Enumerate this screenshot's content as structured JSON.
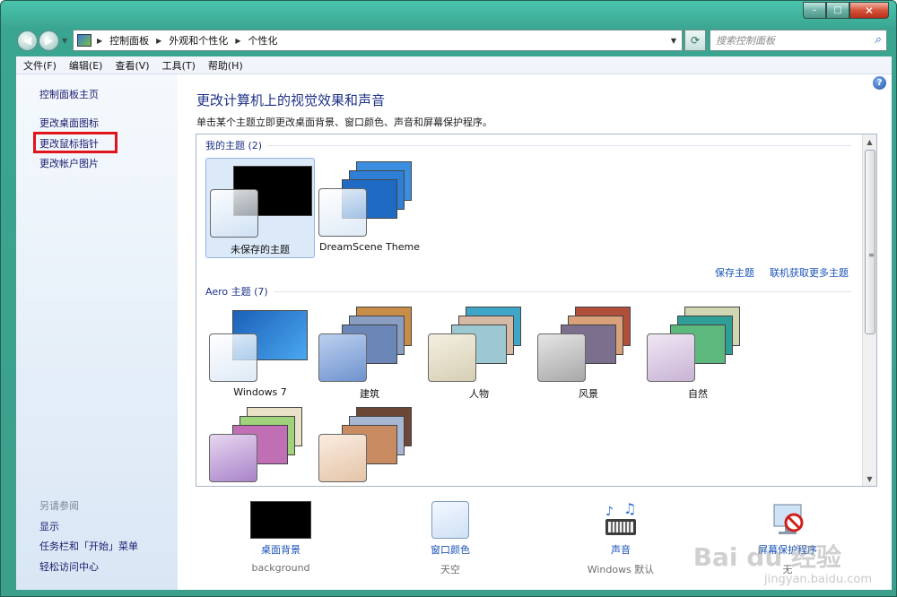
{
  "caption": {
    "minimize": "–",
    "maximize": "□",
    "close": "✕"
  },
  "nav": {
    "back": "◀",
    "forward": "▶",
    "breadcrumb": [
      "控制面板",
      "外观和个性化",
      "个性化"
    ],
    "separator": "▶",
    "search_placeholder": "搜索控制面板"
  },
  "menu": [
    "文件(F)",
    "编辑(E)",
    "查看(V)",
    "工具(T)",
    "帮助(H)"
  ],
  "sidebar": {
    "home": "控制面板主页",
    "links": [
      "更改桌面图标",
      "更改鼠标指针",
      "更改帐户图片"
    ],
    "see_also_heading": "另请参阅",
    "see_also": [
      "显示",
      "任务栏和「开始」菜单",
      "轻松访问中心"
    ]
  },
  "main": {
    "title": "更改计算机上的视觉效果和声音",
    "subtitle": "单击某个主题立即更改桌面背景、窗口颜色、声音和屏幕保护程序。",
    "help": "?",
    "my_themes_header": "我的主题 (2)",
    "my_themes": [
      {
        "label": "未保存的主题",
        "back_color": "#000000"
      },
      {
        "label": "DreamScene Theme",
        "back_color": "#2f7fd6"
      }
    ],
    "save_theme": "保存主题",
    "get_more_online": "联机获取更多主题",
    "aero_header": "Aero 主题 (7)",
    "aero_themes": [
      {
        "label": "Windows 7",
        "back_color": "#2a7fd8"
      },
      {
        "label": "建筑",
        "back_color": "#6a87b8"
      },
      {
        "label": "人物",
        "back_color": "#9cc8d2"
      },
      {
        "label": "风景",
        "back_color": "#7b6f8d"
      },
      {
        "label": "自然",
        "back_color": "#5db87e"
      },
      {
        "label": "",
        "back_color": "#c06fb5"
      },
      {
        "label": "",
        "back_color": "#c98b62"
      }
    ]
  },
  "bottom": [
    {
      "label": "桌面背景",
      "value": "background"
    },
    {
      "label": "窗口颜色",
      "value": "天空"
    },
    {
      "label": "声音",
      "value": "Windows 默认"
    },
    {
      "label": "屏幕保护程序",
      "value": "无"
    }
  ],
  "watermark": {
    "text": "Bai du 经验",
    "sub": "jingyan.baidu.com"
  }
}
